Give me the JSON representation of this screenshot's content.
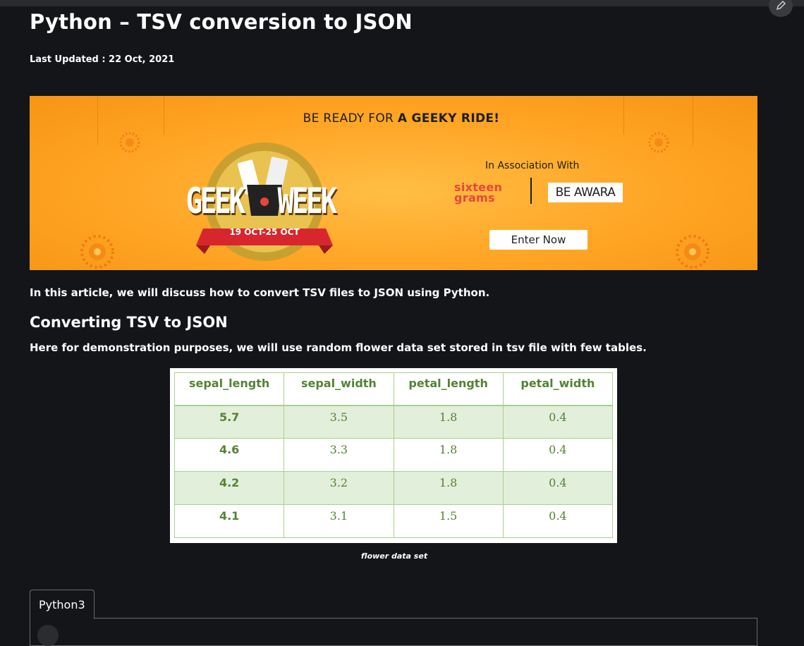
{
  "header": {
    "title": "Python – TSV conversion to JSON",
    "last_updated": "Last Updated : 22 Oct, 2021"
  },
  "banner": {
    "headline_prefix": "BE READY FOR ",
    "headline_bold": "A GEEKY RIDE!",
    "event_left": "GEEK",
    "event_right": "WEEK",
    "dates": "19 OCT-25 OCT",
    "association": "In Association With",
    "sponsor_1_line1": "sixteen",
    "sponsor_1_line2": "grams",
    "sponsor_2": "BE AWARA",
    "cta": "Enter Now"
  },
  "article": {
    "intro": "In this article, we will discuss how to convert TSV files to JSON using Python.",
    "section_heading": "Converting TSV to JSON",
    "demo_text": "Here for demonstration purposes, we will use random flower data set stored in tsv file with few tables."
  },
  "table": {
    "headers": [
      "sepal_length",
      "sepal_width",
      "petal_length",
      "petal_width"
    ],
    "rows": [
      [
        "5.7",
        "3.5",
        "1.8",
        "0.4"
      ],
      [
        "4.6",
        "3.3",
        "1.8",
        "0.4"
      ],
      [
        "4.2",
        "3.2",
        "1.8",
        "0.4"
      ],
      [
        "4.1",
        "3.1",
        "1.5",
        "0.4"
      ]
    ],
    "caption": "flower data set"
  },
  "code": {
    "tab_label": "Python3"
  },
  "colors": {
    "background": "#141518",
    "banner_orange": "#ffa424",
    "table_green_text": "#548235",
    "table_alt_row": "#e2efda",
    "table_border": "#a9d08e"
  }
}
